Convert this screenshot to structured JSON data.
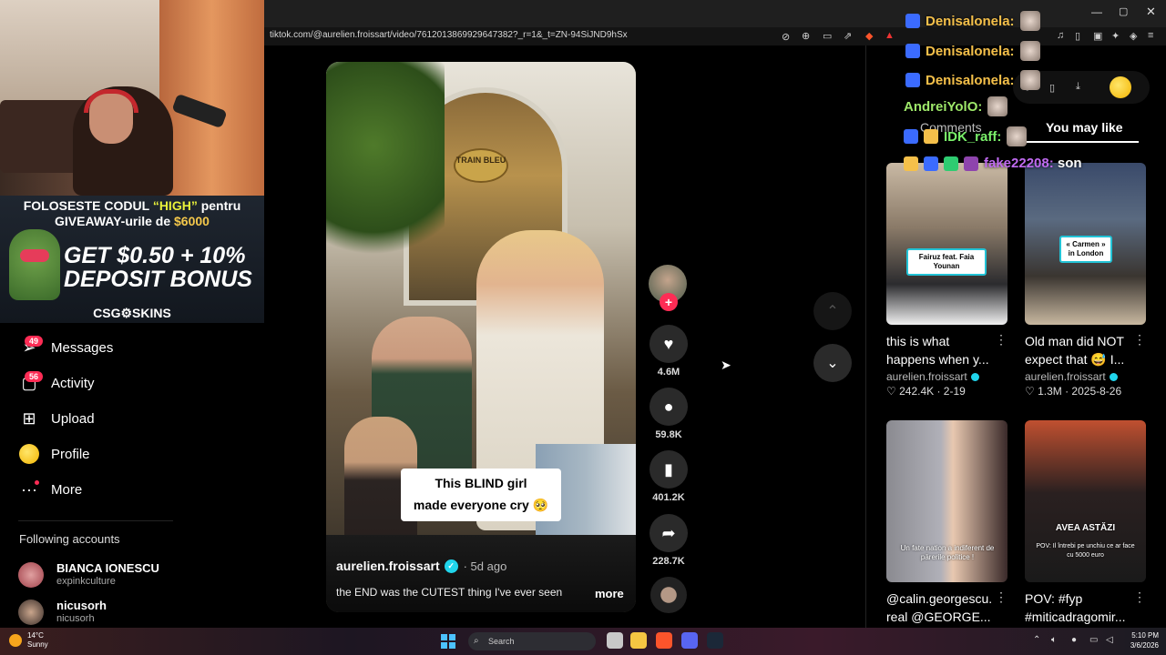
{
  "browser": {
    "url": "tiktok.com/@aurelien.froissart/video/7612013869929647382?_r=1&_t=ZN-94SiJND9hSx",
    "window_controls": {
      "minimize": "—",
      "maximize": "▢",
      "close": "✕"
    }
  },
  "stream_overlay": {
    "promo_line1_a": "FOLOSESTE CODUL ",
    "promo_code": "“HIGH”",
    "promo_line1_b": " pentru",
    "promo_line2_a": "GIVEAWAY-urile de ",
    "promo_amount": "$6000",
    "promo_bonus_line1": "GET $0.50 + 10%",
    "promo_bonus_line2": "DEPOSIT BONUS",
    "promo_brand": "CSG⚙SKINS",
    "chat": [
      {
        "user": "Denisalonela:",
        "color": "#f5c04a",
        "text": ""
      },
      {
        "user": "Denisalonela:",
        "color": "#f5c04a",
        "text": ""
      },
      {
        "user": "Denisalonela:",
        "color": "#f5c04a",
        "text": ""
      },
      {
        "user": "AndreiYolO:",
        "color": "#9ee86a",
        "text": ""
      },
      {
        "user": "IDK_raff:",
        "color": "#7af06a",
        "text": ""
      },
      {
        "user": "fake22208:",
        "color": "#c06af0",
        "text": "son"
      }
    ]
  },
  "sidebar": {
    "nav": [
      {
        "label": "Messages",
        "icon": "send-icon",
        "badge": "49"
      },
      {
        "label": "Activity",
        "icon": "inbox-icon",
        "badge": "56"
      },
      {
        "label": "Upload",
        "icon": "plus-square-icon",
        "badge": ""
      },
      {
        "label": "Profile",
        "icon": "profile-emoji-icon",
        "badge": ""
      },
      {
        "label": "More",
        "icon": "more-dots-icon",
        "badge": ""
      }
    ],
    "following_title": "Following accounts",
    "accounts": [
      {
        "name": "BIANCA IONESCU",
        "handle": "expinkculture"
      },
      {
        "name": "nicusorh",
        "handle": "nicusorh"
      }
    ]
  },
  "video": {
    "sign_text": "TRAIN BLEU",
    "caption_line1": "This BLIND girl",
    "caption_line2": "made everyone cry 🥺",
    "author": "aurelien.froissart",
    "age": "· 5d ago",
    "description": "the END was the CUTEST thing I've ever seen",
    "more_label": "more",
    "likes": "4.6M",
    "comments": "59.8K",
    "saves": "401.2K",
    "shares": "228.7K"
  },
  "right_panel": {
    "tab_comments": "Comments",
    "tab_you_may_like": "You may like",
    "cards": [
      {
        "title": "this is what",
        "title2": "happens when y...",
        "author": "aurelien.froissart",
        "verified": true,
        "likes": "♡ 242.4K · 2-19",
        "label": "Fairuz feat. Faia Younan"
      },
      {
        "title": "Old man did NOT",
        "title2": "expect that 😅 I...",
        "author": "aurelien.froissart",
        "verified": true,
        "likes": "♡ 1.3M · 2025-8-26",
        "label": "« Carmen » in London"
      },
      {
        "title": "@calin.georgescu.",
        "title2": "real @GEORGE...",
        "author": "",
        "verified": false,
        "likes": "",
        "label": "Un fate nation a indiferent de pārerile politice !"
      },
      {
        "title": "POV: #fyp",
        "title2": "#miticadragomir...",
        "author": "",
        "verified": false,
        "likes": "",
        "label": "AVEA ASTĂZI",
        "label2": "POV: Il întrebi pe unchiu ce ar face cu 5000 euro"
      }
    ]
  },
  "taskbar": {
    "temp": "14°C",
    "weather": "Sunny",
    "search": "Search",
    "time": "5:10 PM",
    "date": "3/6/2026"
  }
}
